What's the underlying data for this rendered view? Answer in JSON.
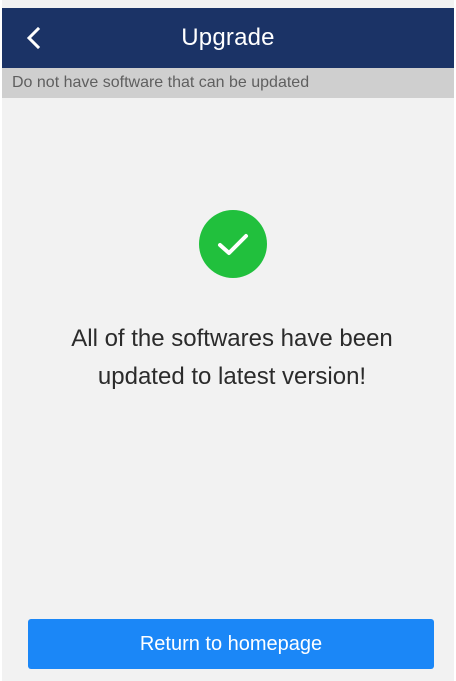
{
  "header": {
    "title": "Upgrade",
    "back_icon": "chevron-left-icon",
    "background_color": "#1b3366"
  },
  "notice": {
    "text": "Do not have software that can be updated"
  },
  "status": {
    "icon": "check-circle-icon",
    "icon_color": "#21c03d",
    "line1": "All of the softwares have been",
    "line2": "updated to latest version!"
  },
  "actions": {
    "return_label": "Return to homepage",
    "button_color": "#1b87f7"
  }
}
